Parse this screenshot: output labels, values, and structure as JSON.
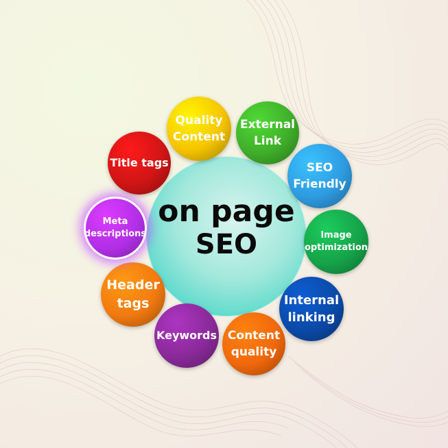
{
  "center": {
    "line1": "on page",
    "line2": "SEO"
  },
  "nodes": [
    {
      "id": "quality-content",
      "label": "Quality\nContent",
      "color": "#f5c400"
    },
    {
      "id": "external-link",
      "label": "External\nLink",
      "color": "#3fae2a"
    },
    {
      "id": "seo-friendly",
      "label": "SEO\nFriendly",
      "color": "#2e9be0"
    },
    {
      "id": "image-optimization",
      "label": "Image\noptimization",
      "color": "#16a34a"
    },
    {
      "id": "internal-linking",
      "label": "Internal\nlinking",
      "color": "#0b4aa8"
    },
    {
      "id": "content-quality",
      "label": "Content\nquality",
      "color": "#f0680c"
    },
    {
      "id": "keywords",
      "label": "Keywords",
      "color": "#8a2a9a"
    },
    {
      "id": "header-tags",
      "label": "Header\ntags",
      "color": "#f27a10"
    },
    {
      "id": "meta-descriptions",
      "label": "Meta\ndescriptions",
      "color": "#b12fe6"
    },
    {
      "id": "title-tags",
      "label": "Title tags",
      "color": "#d01515"
    }
  ]
}
